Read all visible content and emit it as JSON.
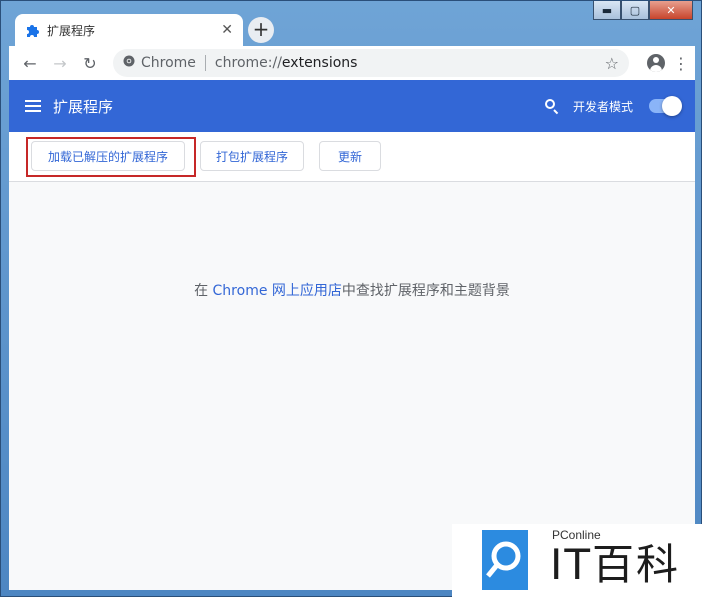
{
  "tab": {
    "title": "扩展程序",
    "close": "✕",
    "new_tab": "+"
  },
  "toolbar": {
    "back": "←",
    "forward": "→",
    "reload": "↻",
    "site_name": "Chrome",
    "url_scheme": "chrome://",
    "url_path": "extensions",
    "star": "☆",
    "menu": "⋮"
  },
  "window_controls": {
    "minimize": "▬",
    "maximize": "▢",
    "close": "✕"
  },
  "header": {
    "title": "扩展程序",
    "dev_mode_label": "开发者模式",
    "dev_mode_on": true,
    "color": "#3367d6"
  },
  "actions": {
    "load_unpacked": "加载已解压的扩展程序",
    "pack": "打包扩展程序",
    "update": "更新"
  },
  "content": {
    "prefix": "在 ",
    "store_link": "Chrome 网上应用店",
    "suffix": "中查找扩展程序和主题背景"
  },
  "watermark": {
    "brand": "PConline",
    "name": "IT百科"
  }
}
